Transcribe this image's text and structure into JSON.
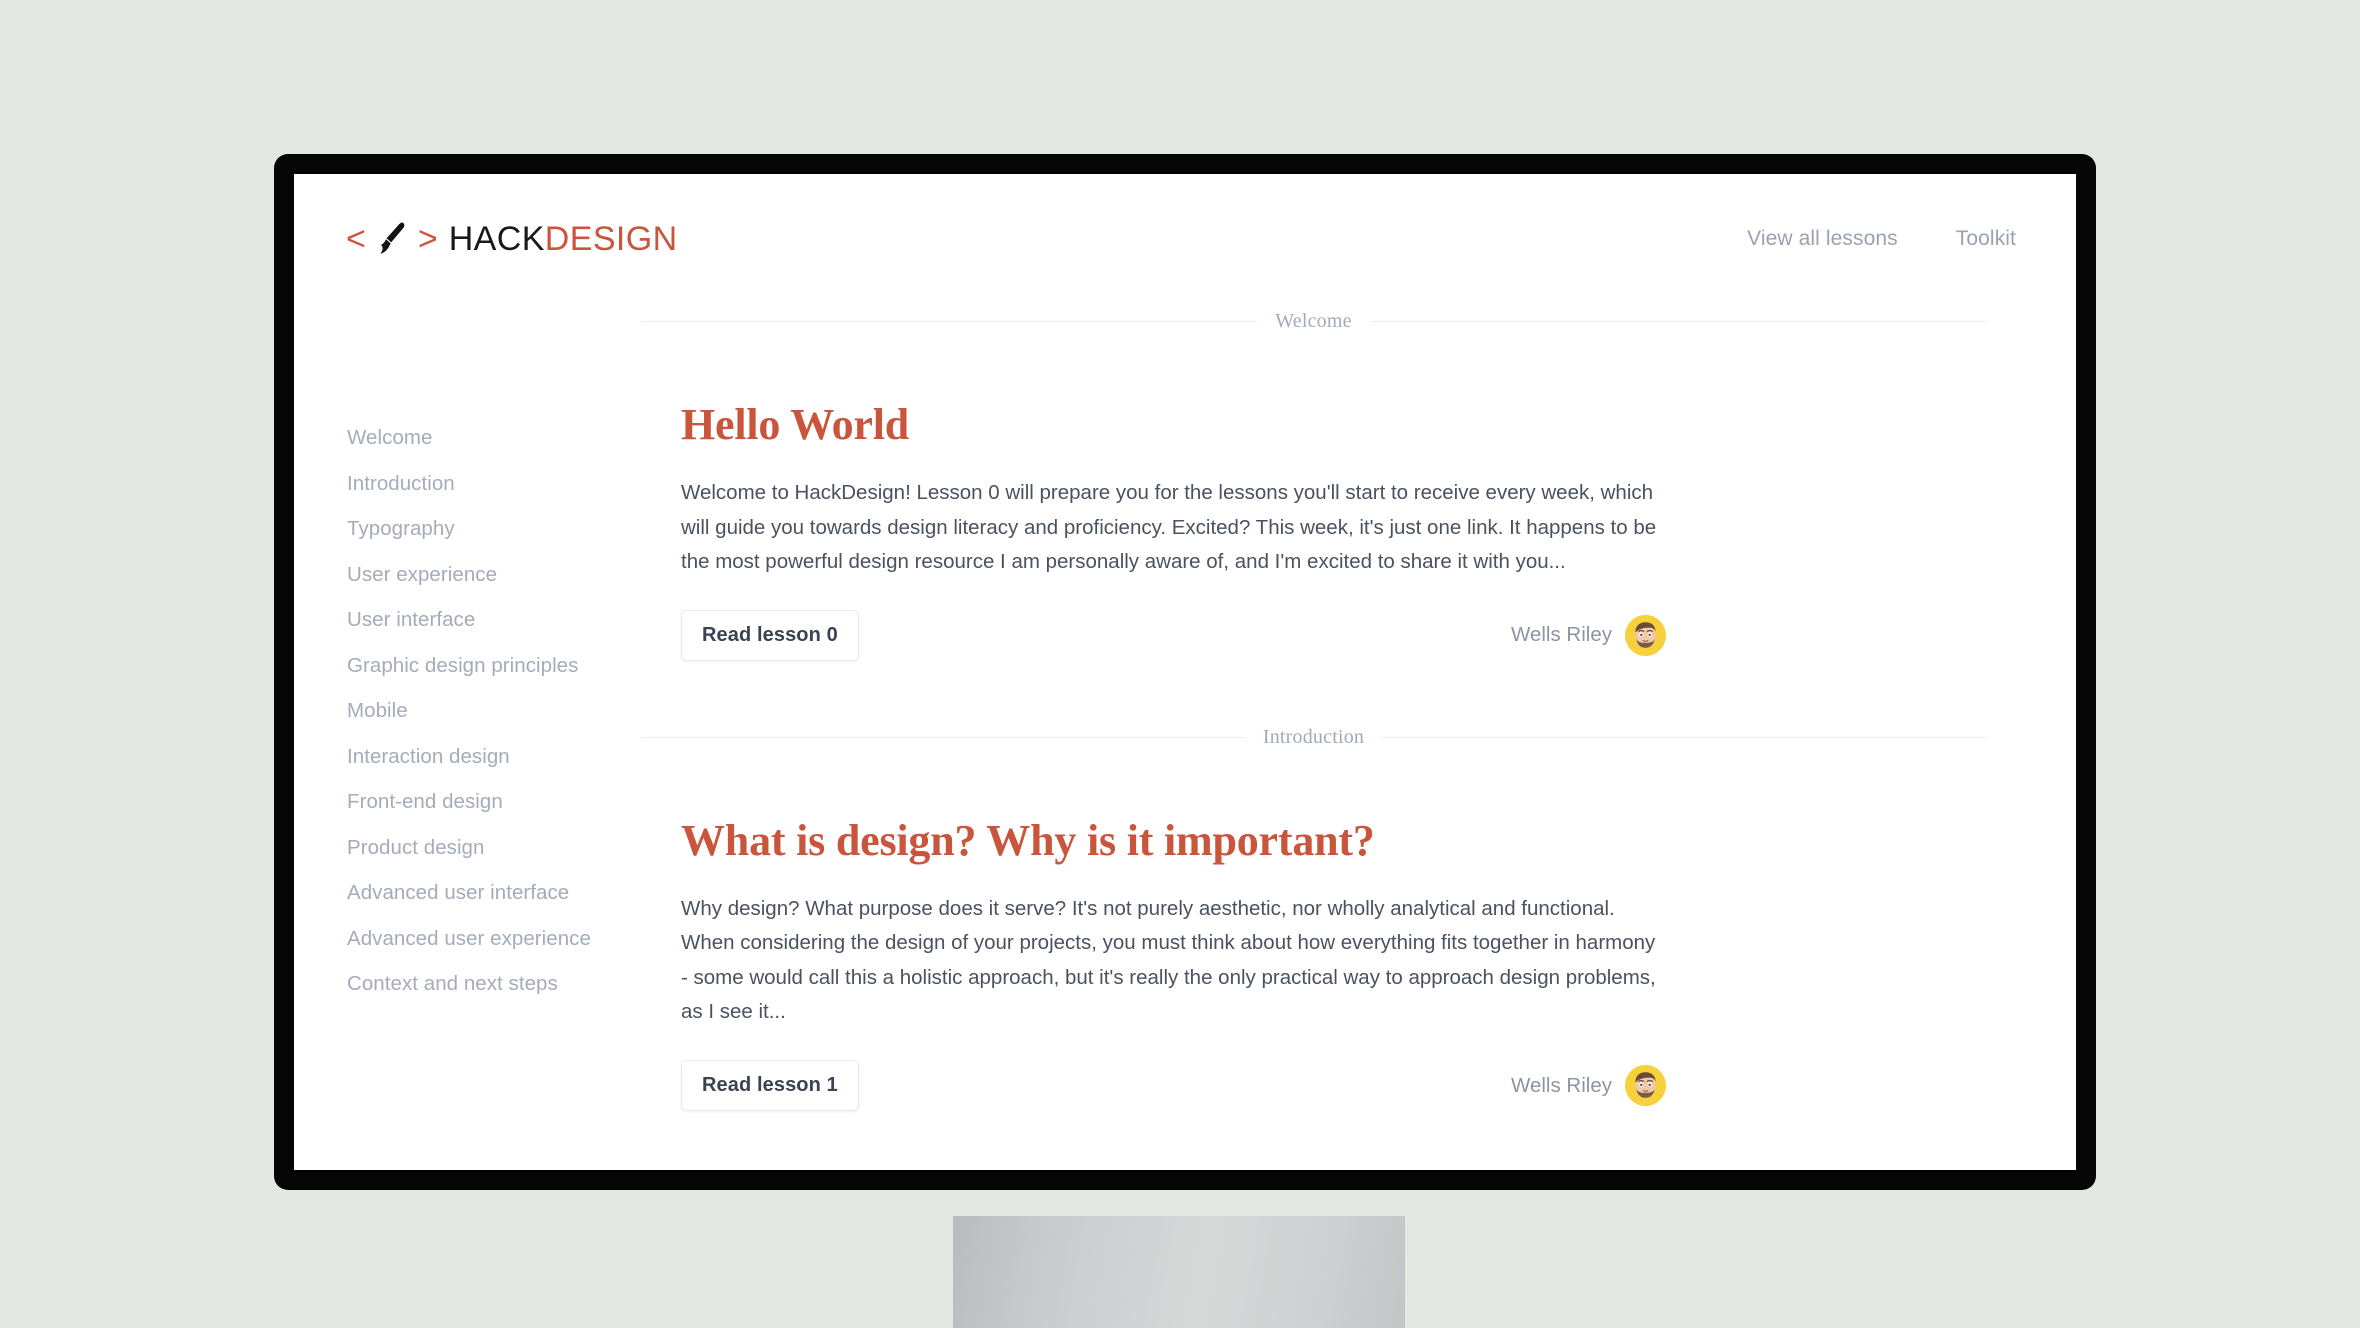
{
  "site": {
    "background_color": "#e3e8e2",
    "accent_color": "#c9563c",
    "brand": {
      "logo_icon": "code-brackets-paintbrush-icon",
      "name_part_1": "HACK",
      "name_part_2": "DESIGN"
    },
    "nav": [
      {
        "label": "View all lessons",
        "name": "nav-view-all-lessons"
      },
      {
        "label": "Toolkit",
        "name": "nav-toolkit"
      }
    ]
  },
  "sidebar": {
    "items": [
      {
        "label": "Welcome"
      },
      {
        "label": "Introduction"
      },
      {
        "label": "Typography"
      },
      {
        "label": "User experience"
      },
      {
        "label": "User interface"
      },
      {
        "label": "Graphic design principles"
      },
      {
        "label": "Mobile"
      },
      {
        "label": "Interaction design"
      },
      {
        "label": "Front-end design"
      },
      {
        "label": "Product design"
      },
      {
        "label": "Advanced user interface"
      },
      {
        "label": "Advanced user experience"
      },
      {
        "label": "Context and next steps"
      }
    ]
  },
  "lessons": [
    {
      "section": "Welcome",
      "title": "Hello World",
      "excerpt": "Welcome to HackDesign! Lesson 0 will prepare you for the lessons you'll start to receive every week, which will guide you towards design literacy and proficiency. Excited? This week, it's just one link. It happens to be the most powerful design resource I am personally aware of, and I'm excited to share it with you...",
      "button_label": "Read lesson 0",
      "author": "Wells Riley",
      "avatar_icon": "memoji-avatar",
      "avatar_background": "#f7d13c"
    },
    {
      "section": "Introduction",
      "title": "What is design? Why is it important?",
      "excerpt": "Why design? What purpose does it serve? It's not purely aesthetic, nor wholly analytical and functional. When considering the design of your projects, you must think about how everything fits together in harmony - some would call this a holistic approach, but it's really the only practical way to approach design problems, as I see it...",
      "button_label": "Read lesson 1",
      "author": "Wells Riley",
      "avatar_icon": "memoji-avatar",
      "avatar_background": "#f7d13c"
    }
  ]
}
